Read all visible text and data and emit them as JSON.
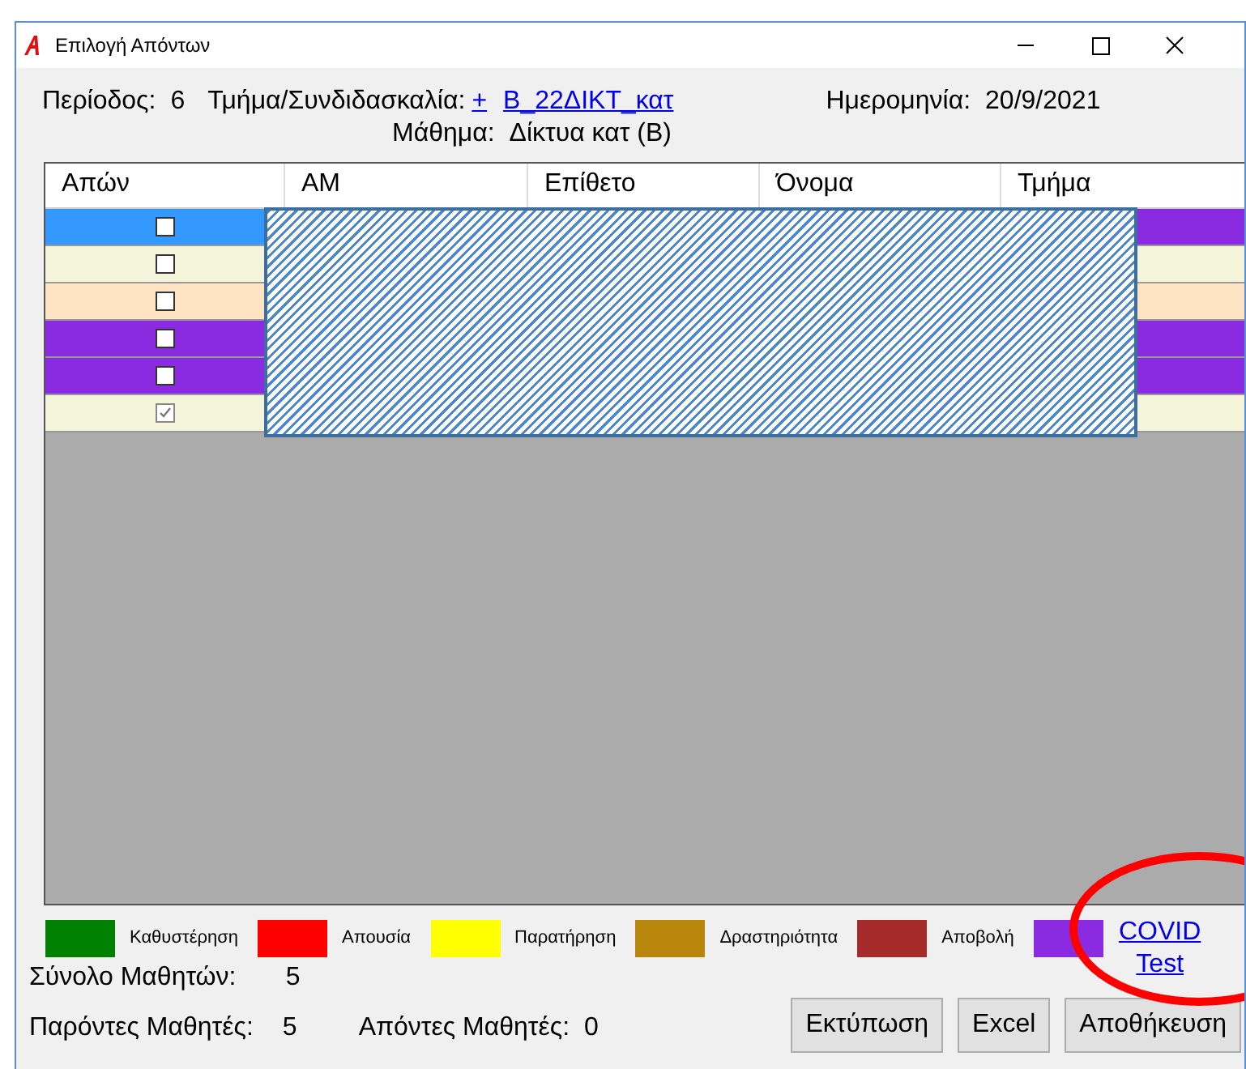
{
  "window": {
    "title": "Επιλογή Απόντων"
  },
  "header": {
    "period_label": "Περίοδος:",
    "period": "6",
    "class_label": "Τμήμα/Συνδιδασκαλία:",
    "add_link": "+",
    "class_link": "Β_22ΔΙΚΤ_κατ",
    "date_label": "Ημερομηνία:",
    "date": "20/9/2021",
    "subject_label": "Μάθημα:",
    "subject": "Δίκτυα κατ (Β)"
  },
  "table": {
    "columns": [
      "Απών",
      "ΑΜ",
      "Επίθετο",
      "Όνομα",
      "Τμήμα"
    ],
    "rows": [
      {
        "selected": true,
        "checked": false,
        "color": "#8a2be2"
      },
      {
        "selected": false,
        "checked": false,
        "color": "#f5f5dc"
      },
      {
        "selected": false,
        "checked": false,
        "color": "#ffe4c4"
      },
      {
        "selected": false,
        "checked": false,
        "color": "#8a2be2"
      },
      {
        "selected": false,
        "checked": false,
        "color": "#8a2be2"
      },
      {
        "selected": false,
        "checked": true,
        "color": "#f5f5dc"
      }
    ]
  },
  "legend": [
    {
      "label": "Καθυστέρηση",
      "color": "#008000"
    },
    {
      "label": "Απουσία",
      "color": "#ff0000"
    },
    {
      "label": "Παρατήρηση",
      "color": "#ffff00"
    },
    {
      "label": "Δραστηριότητα",
      "color": "#b8860b"
    },
    {
      "label": "Αποβολή",
      "color": "#a52a2a"
    },
    {
      "label": "COVID Test",
      "color": "#8a2be2",
      "kind": "link"
    }
  ],
  "totals": {
    "total_label": "Σύνολο Μαθητών:",
    "total": "5",
    "present_label": "Παρόντες Μαθητές:",
    "present": "5",
    "absent_label": "Απόντες Μαθητές:",
    "absent": "0"
  },
  "buttons": [
    "Εκτύπωση",
    "Excel",
    "Αποθήκευση"
  ]
}
